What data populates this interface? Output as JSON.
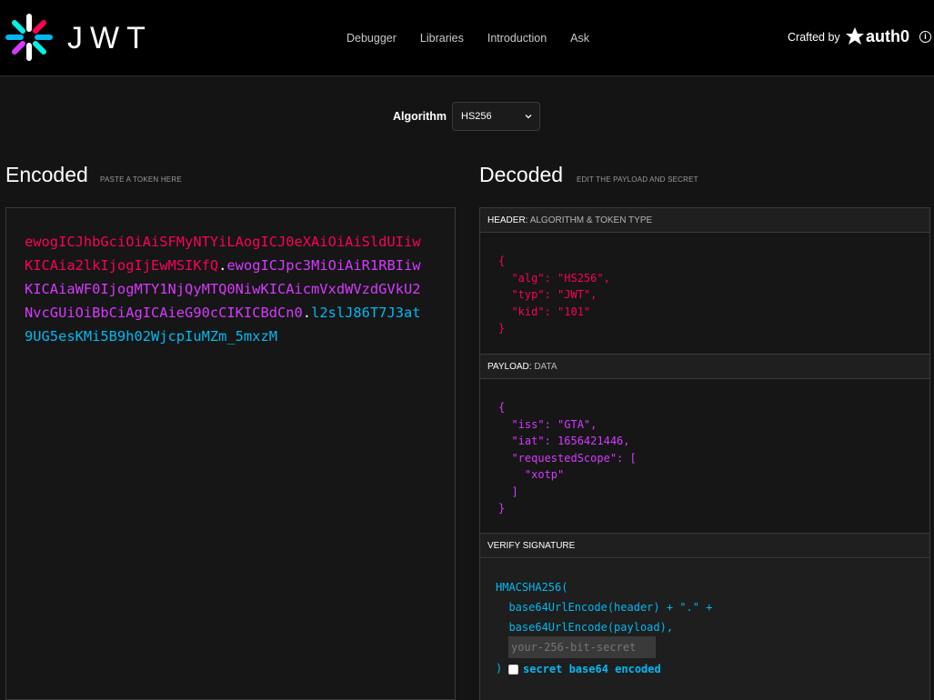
{
  "brand": {
    "logo_text": "JWT"
  },
  "nav": {
    "items": [
      "Debugger",
      "Libraries",
      "Introduction",
      "Ask"
    ]
  },
  "crafted": {
    "label": "Crafted by",
    "company": "auth0"
  },
  "algorithm": {
    "label": "Algorithm",
    "selected": "HS256"
  },
  "encoded": {
    "title": "Encoded",
    "subtitle": "PASTE A TOKEN HERE",
    "token_header": "ewogICJhbGciOiAiSFMyNTYiLAogICJ0eXAiOiAiSldUIiwKICAia2lkIjogIjEwMSIKfQ",
    "token_payload": "ewogICJpc3MiOiAiR1RBIiwKICAiaWF0IjogMTY1NjQyMTQ0NiwKICAicmVxdWVzdGVkU2NvcGUiOiBbCiAgICAieG90cCIKICBdCn0",
    "token_signature": "l2slJ86T7J3at9UG5esKMi5B9h02WjcpIuMZm_5mxzM",
    "dot": "."
  },
  "decoded": {
    "title": "Decoded",
    "subtitle": "EDIT THE PAYLOAD AND SECRET",
    "header_bar": {
      "label": "HEADER:",
      "sub": "ALGORITHM & TOKEN TYPE"
    },
    "header_json": "{\n  \"alg\": \"HS256\",\n  \"typ\": \"JWT\",\n  \"kid\": \"101\"\n}",
    "payload_bar": {
      "label": "PAYLOAD:",
      "sub": "DATA"
    },
    "payload_json": "{\n  \"iss\": \"GTA\",\n  \"iat\": 1656421446,\n  \"requestedScope\": [\n    \"xotp\"\n  ]\n}",
    "signature_bar": {
      "label": "VERIFY SIGNATURE"
    },
    "signature_code": "HMACSHA256(\n  base64UrlEncode(header) + \".\" +\n  base64UrlEncode(payload),\n",
    "secret_placeholder": "your-256-bit-secret",
    "closing_paren": ")",
    "checkbox_label": "secret base64 encoded"
  },
  "colors": {
    "header": "#fb015b",
    "payload": "#d63aff",
    "signature": "#00b9f1"
  }
}
